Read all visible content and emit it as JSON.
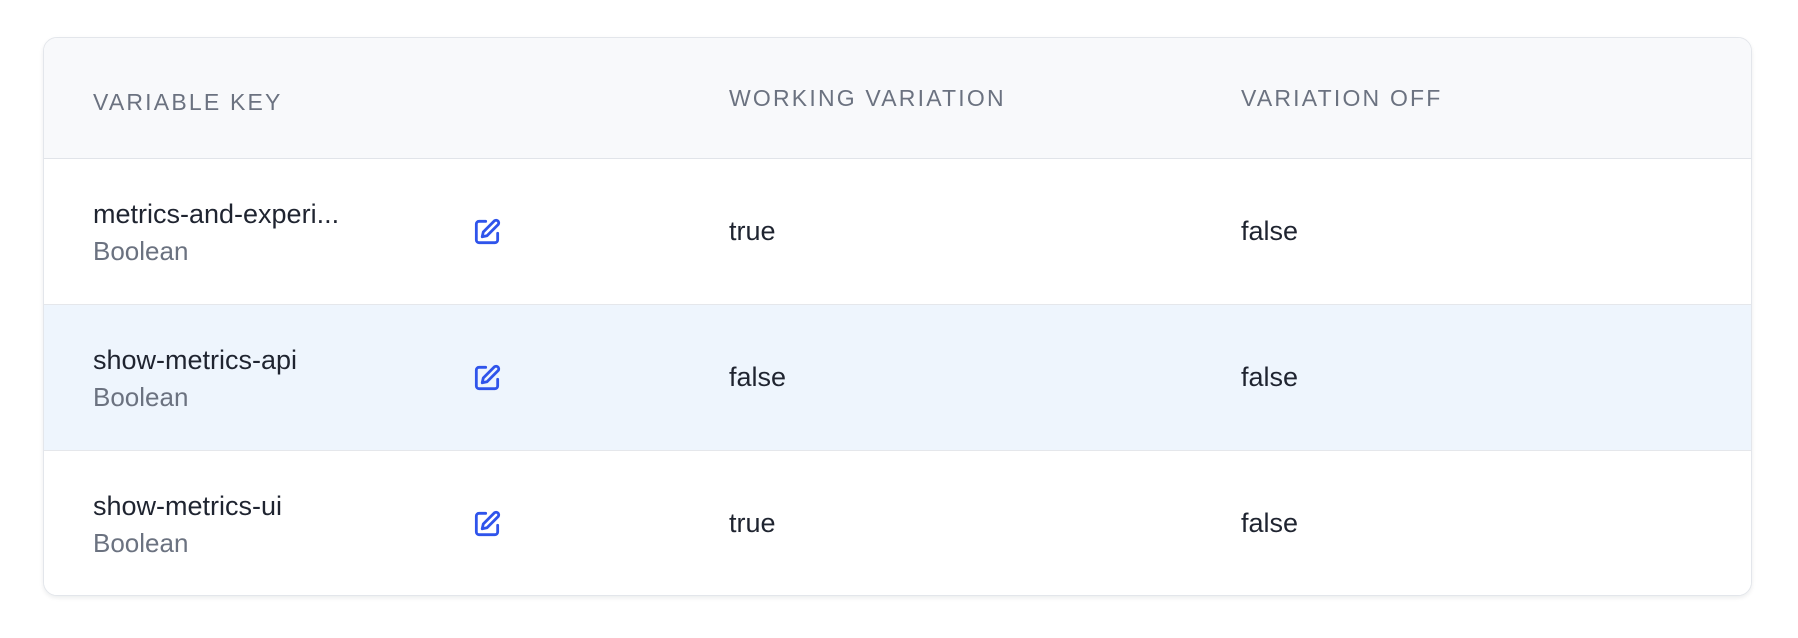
{
  "table": {
    "headers": {
      "variable_key": "VARIABLE KEY",
      "working_variation": "WORKING VARIATION",
      "variation_off": "VARIATION OFF"
    },
    "rows": [
      {
        "key": "metrics-and-experi...",
        "type": "Boolean",
        "working": "true",
        "off": "false",
        "highlighted": false
      },
      {
        "key": "show-metrics-api",
        "type": "Boolean",
        "working": "false",
        "off": "false",
        "highlighted": true
      },
      {
        "key": "show-metrics-ui",
        "type": "Boolean",
        "working": "true",
        "off": "false",
        "highlighted": false
      }
    ]
  },
  "colors": {
    "edit_icon": "#2f54eb",
    "highlight_row": "#eef5fd",
    "header_bg": "#f8f9fb"
  },
  "icons": {
    "edit": "edit-icon"
  }
}
